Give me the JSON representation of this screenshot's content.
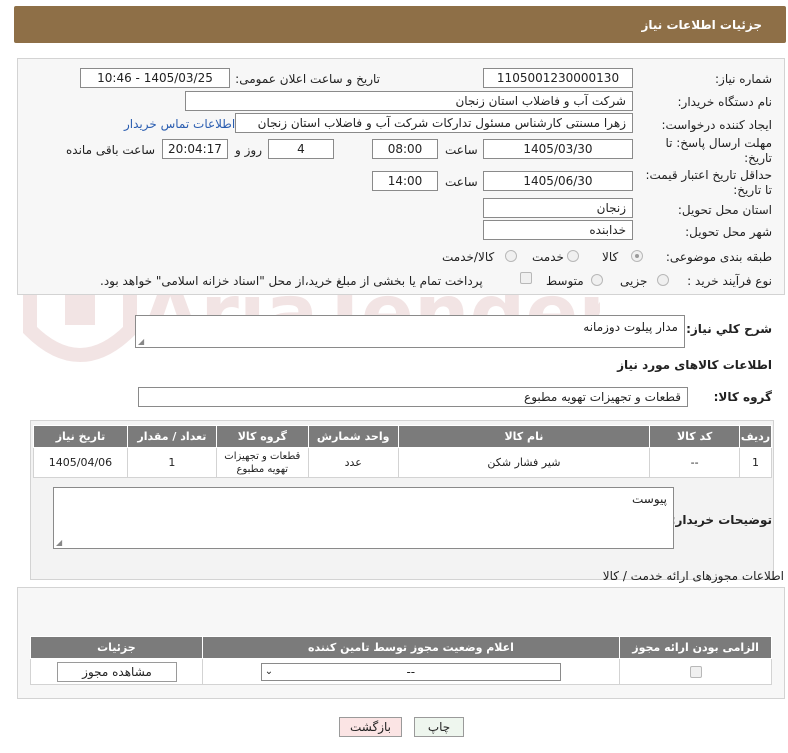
{
  "header": {
    "title": "جزئیات اطلاعات نیاز"
  },
  "form": {
    "need_number_label": "شماره نیاز:",
    "need_number": "1105001230000130",
    "announce_label": "تاریخ و ساعت اعلان عمومی:",
    "announce_value": "1405/03/25 - 10:46",
    "buyer_org_label": "نام دستگاه خریدار:",
    "buyer_org": "شرکت آب و فاضلاب استان زنجان",
    "creator_label": "ایجاد کننده درخواست:",
    "creator": "زهرا مسنتی کارشناس مسئول تدارکات شرکت آب و فاضلاب استان زنجان",
    "contact_link": "اطلاعات تماس خریدار",
    "deadline_label_1": "مهلت ارسال پاسخ: تا",
    "deadline_label_2": "تاریخ:",
    "deadline_date": "1405/03/30",
    "time_label": "ساعت",
    "deadline_time": "08:00",
    "days": "4",
    "days_label": "روز و",
    "remaining": "20:04:17",
    "remaining_label": "ساعت باقی مانده",
    "validity_label_1": "حداقل تاریخ اعتبار قیمت:",
    "validity_label_2": "تا تاریخ:",
    "validity_date": "1405/06/30",
    "validity_time": "14:00",
    "province_label": "استان محل تحویل:",
    "province": "زنجان",
    "city_label": "شهر محل تحویل:",
    "city": "خدابنده",
    "category_label": "طبقه بندی موضوعی:",
    "category_options": [
      "کالا",
      "خدمت",
      "کالا/خدمت"
    ],
    "process_label": "نوع فرآیند خرید :",
    "process_options": [
      "جزیی",
      "متوسط"
    ],
    "payment_note": "پرداخت تمام یا بخشی از مبلغ خرید،از محل \"اسناد خزانه اسلامی\" خواهد بود."
  },
  "desc": {
    "label": "شرح كلي نياز:",
    "value": "مدار پیلوت دوزمانه",
    "goods_info_title": "اطلاعات کالاهای مورد نیاز",
    "group_label": "گروه کالا:",
    "group_value": "قطعات و تجهیزات تهویه مطبوع"
  },
  "goods_table": {
    "headers": [
      "ردیف",
      "کد کالا",
      "نام کالا",
      "واحد شمارش",
      "گروه کالا",
      "تعداد / مقدار",
      "تاریخ نیاز"
    ],
    "rows": [
      [
        "1",
        "--",
        "شیر فشار شکن",
        "عدد",
        "قطعات و تجهیزات تهویه مطبوع",
        "1",
        "1405/04/06"
      ]
    ]
  },
  "buyer_notes": {
    "label": "توضیحات خریدار:",
    "value": "پیوست"
  },
  "permits": {
    "title": "اطلاعات مجوزهای ارائه خدمت / کالا",
    "headers": [
      "الزامی بودن ارائه مجوز",
      "اعلام وضعیت مجوز توسط تامین کننده",
      "جزئیات"
    ],
    "select_value": "--",
    "view_button": "مشاهده مجوز"
  },
  "actions": {
    "print": "چاپ",
    "back": "بازگشت"
  },
  "watermark": {
    "text": "AriaTender.net"
  }
}
